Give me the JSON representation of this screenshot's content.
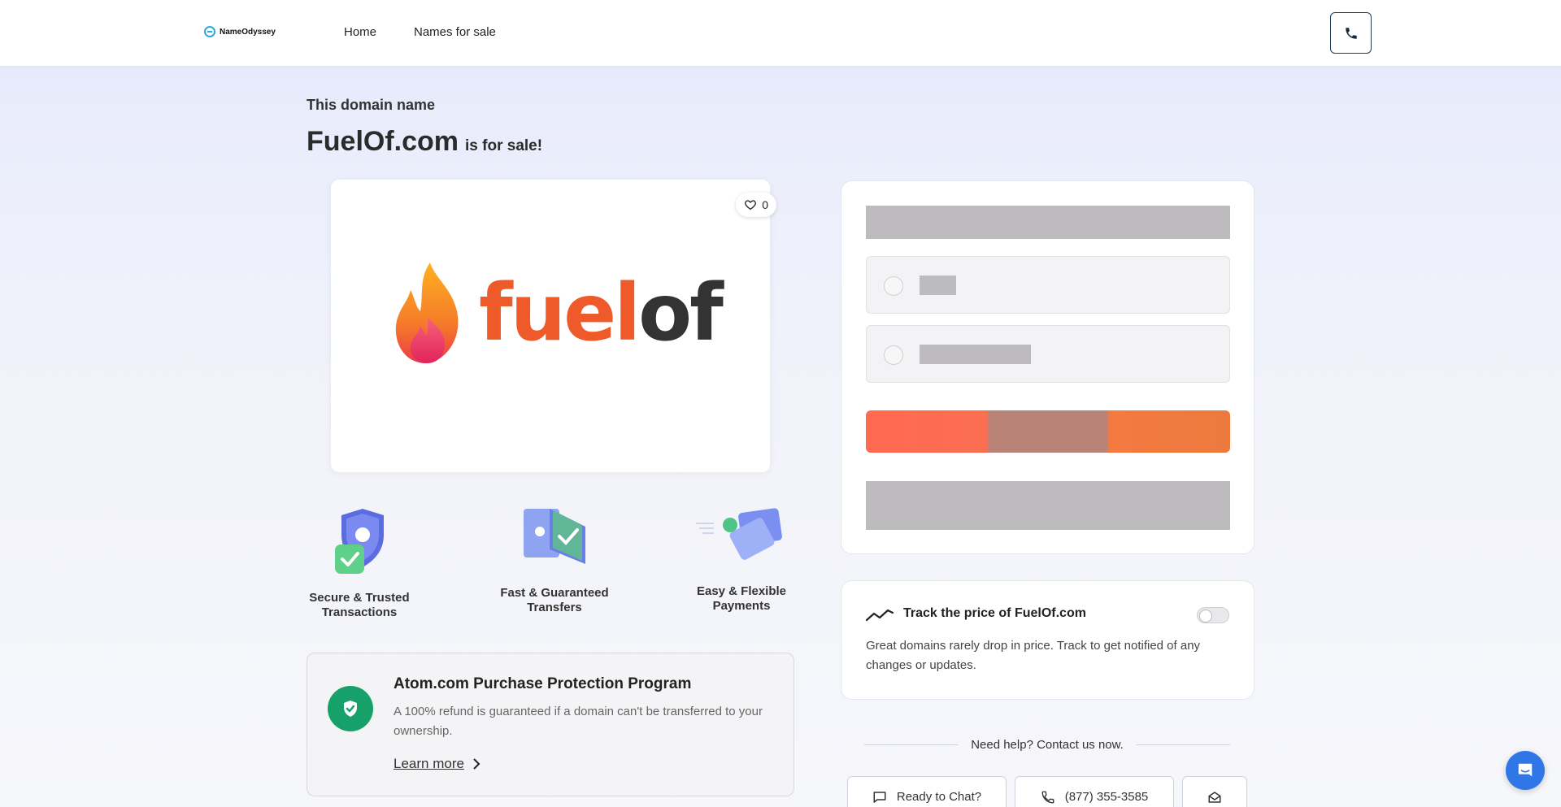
{
  "header": {
    "logo_text": "NameOdyssey",
    "nav": [
      {
        "label": "Home"
      },
      {
        "label": "Names for sale"
      }
    ]
  },
  "hero": {
    "intro": "This domain name",
    "domain": "FuelOf.com",
    "suffix": "is for sale!"
  },
  "logo_card": {
    "like_count": "0",
    "brand_fuel": "fuel",
    "brand_of": "of"
  },
  "features": [
    {
      "line1": "Secure & Trusted",
      "line2": "Transactions",
      "icon": "shield-check-icon"
    },
    {
      "line1": "Fast & Guaranteed",
      "line2": "Transfers",
      "icon": "transfer-icon"
    },
    {
      "line1": "Easy & Flexible",
      "line2": "Payments",
      "icon": "credit-card-icon"
    }
  ],
  "protection": {
    "title": "Atom.com Purchase Protection Program",
    "description": "A 100% refund is guaranteed if a domain can't be transferred to your ownership.",
    "link": "Learn more"
  },
  "track": {
    "title": "Track the price of FuelOf.com",
    "description": "Great domains rarely drop in price. Track to get notified of any changes or updates.",
    "enabled": false
  },
  "help": {
    "text": "Need help? Contact us now.",
    "chat_label": "Ready to Chat?",
    "phone_label": "(877) 355-3585"
  },
  "colors": {
    "accent_green": "#16a06a",
    "buy_button": "#fb6e52",
    "chat_fab": "#2f76e6"
  }
}
